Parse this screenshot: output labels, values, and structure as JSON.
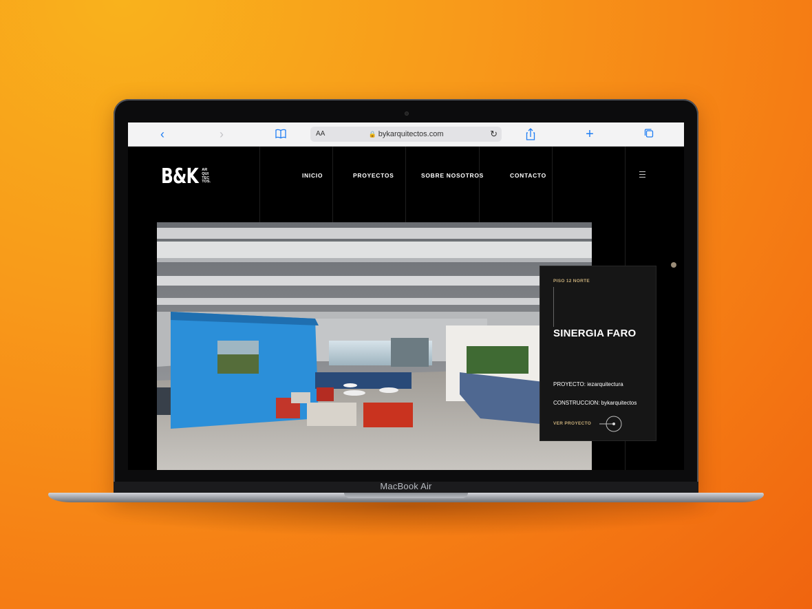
{
  "browser": {
    "url": "bykarquitectos.com",
    "text_size_label": "AA",
    "icons": [
      "back-icon",
      "forward-icon",
      "bookmarks-icon",
      "lock-icon",
      "reload-icon",
      "share-icon",
      "new-tab-icon",
      "tabs-icon"
    ]
  },
  "site": {
    "logo": {
      "main": "B&K",
      "sub_lines": [
        "AR",
        "QUI",
        "TEC",
        "TOS."
      ]
    },
    "nav": [
      {
        "label": "INICIO"
      },
      {
        "label": "PROYECTOS"
      },
      {
        "label": "SOBRE NOSOTROS"
      },
      {
        "label": "CONTACTO"
      }
    ],
    "project": {
      "subtitle": "PISO 12 NORTE",
      "title": "SINERGIA FARO",
      "proyecto": "PROYECTO: iezarquitectura",
      "construccion": "CONSTRUCCION: bykarquitectos",
      "cta": "VER PROYECTO"
    },
    "accent_color": "#c7ad79"
  },
  "device": {
    "label": "MacBook Air"
  }
}
